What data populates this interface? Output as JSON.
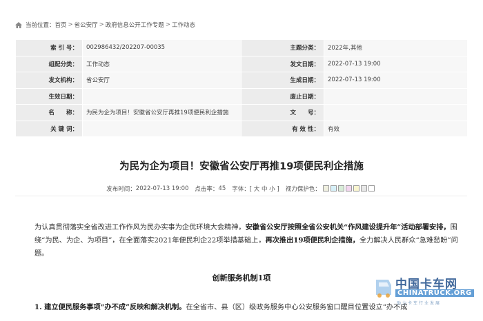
{
  "breadcrumb": {
    "prefix": "当前位置：",
    "items": [
      "首页",
      "省公安厅",
      "政府信息公开工作专题",
      "工作动态"
    ],
    "separator": ">"
  },
  "meta": {
    "rows": [
      [
        {
          "k": "索 引 号：",
          "v": "002986432/202207-00035"
        },
        {
          "k": "主题分类：",
          "v": "2022年,其他"
        }
      ],
      [
        {
          "k": "组配分类：",
          "v": "工作动态"
        },
        {
          "k": "发文日期：",
          "v": "2022-07-13 19:00"
        }
      ],
      [
        {
          "k": "发文机构：",
          "v": "省公安厅"
        },
        {
          "k": "生成日期：",
          "v": "2022-07-13 19:00"
        }
      ],
      [
        {
          "k": "生效日期：",
          "v": ""
        },
        {
          "k": "废止日期：",
          "v": ""
        }
      ],
      [
        {
          "k": "名　　称：",
          "v": "为民为企为项目！安徽省公安厅再推19项便民利企措施"
        },
        {
          "k": "文　　号：",
          "v": ""
        }
      ],
      [
        {
          "k": "关 键 词：",
          "v": ""
        },
        {
          "k": "有 效 性：",
          "v": "有效"
        }
      ]
    ]
  },
  "article": {
    "title": "为民为企为项目！安徽省公安厅再推19项便民利企措施",
    "info": {
      "publish_label": "发布时间：",
      "publish_time": "2022-07-13 19:00",
      "views_label": "点击率：",
      "views": "45",
      "font_label": "字体：[ 大 中 小 ]",
      "eye_label": "视力保护色：",
      "swatch_colors": [
        "#f0f0e0",
        "#d6f0f8",
        "#d8ecd8",
        "#f3d6ef",
        "#f9f5cf",
        "#e8e8e8",
        "#ffffff"
      ]
    },
    "p1_a": "为认真贯彻落实全省改进工作作风为民办实事为企优环境大会精神，",
    "p1_b": "安徽省公安厅按照全省公安机关“作风建设提升年”活动部署安排，",
    "p1_c": "围绕“为民、为企、为项目”，在全面落实2021年便民利企22项举措基础上，",
    "p1_d": "再次推出19项便民利企措施，",
    "p1_e": "全力解决人民群众“急难愁盼”问题。",
    "section_heading": "创新服务机制1项",
    "p2_a": "1. 建立便民服务事项“办不成”反映和解决机制。",
    "p2_b": "在全省市、县（区）级政务服务中心公安服务窗口醒目位置设立“办不成"
  },
  "watermark": {
    "cn": "中国卡车网",
    "en": "CHINATRUCK.ORG",
    "sub": "助力卡车行业发展"
  }
}
